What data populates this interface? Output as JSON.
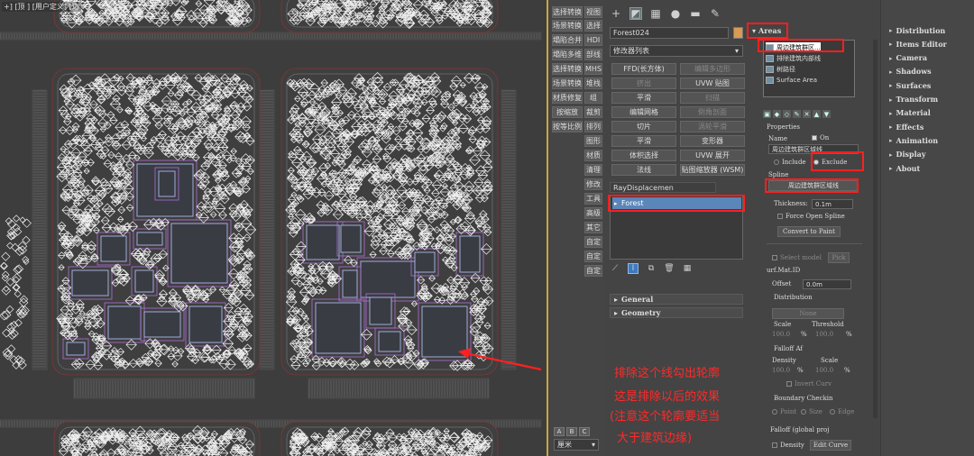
{
  "viewport": {
    "label": "+] [顶 ] [用户定义] [边",
    "annotations": [
      "排除这个线勾出轮廓",
      "这是排除以后的效果",
      "(注意这个轮廓要适当",
      "大于建筑边缘)"
    ]
  },
  "toolstrip": {
    "rows": [
      [
        "选择转换",
        "视图"
      ],
      [
        "场景转换",
        "选择"
      ],
      [
        "塌陷合并",
        "HDI"
      ],
      [
        "塌陷多维",
        "部线"
      ],
      [
        "选择转换",
        "MHS"
      ],
      [
        "场景转换",
        "堆栈"
      ],
      [
        "材质修复",
        "组"
      ],
      [
        "按缩放",
        "裁剪"
      ],
      [
        "按等比例",
        "排列"
      ]
    ],
    "side_items": [
      "图形",
      "材质",
      "清理",
      "修改",
      "工具",
      "高级",
      "其它",
      "自定",
      "自定",
      "自定"
    ],
    "abc": [
      "A",
      "B",
      "C"
    ],
    "unit": "厘米"
  },
  "command_panel": {
    "tab_icons": [
      "plus-icon",
      "modify-icon",
      "hierarchy-icon",
      "motion-icon",
      "display-icon",
      "utilities-icon"
    ],
    "object_name": "Forest024",
    "object_color": "#d99a54",
    "modifier_list": "修改器列表",
    "modifier_buttons": [
      {
        "label": "FFD(长方体)",
        "dim": false
      },
      {
        "label": "编辑多边形",
        "dim": true
      },
      {
        "label": "挤出",
        "dim": true
      },
      {
        "label": "UVW 贴图",
        "dim": false
      },
      {
        "label": "平滑",
        "dim": false
      },
      {
        "label": "扫描",
        "dim": true
      },
      {
        "label": "编辑网格",
        "dim": false
      },
      {
        "label": "倒角剖面",
        "dim": true
      },
      {
        "label": "切片",
        "dim": false
      },
      {
        "label": "涡轮平滑",
        "dim": true
      },
      {
        "label": "平滑",
        "dim": false
      },
      {
        "label": "变形器",
        "dim": false
      },
      {
        "label": "体积选择",
        "dim": false
      },
      {
        "label": "UVW 展开",
        "dim": false
      },
      {
        "label": "法线",
        "dim": false
      },
      {
        "label": "贴图缩放器 (WSM)",
        "dim": false
      }
    ],
    "raydisp": "RayDisplacemen",
    "stack_item": "Forest",
    "rollouts": [
      "General",
      "Geometry"
    ]
  },
  "areas": {
    "header": "Areas",
    "list": [
      {
        "label": "周边建筑群区...",
        "selected": true
      },
      {
        "label": "排除建筑内部线",
        "selected": false
      },
      {
        "label": "树路径",
        "selected": false
      },
      {
        "label": "Surface Area",
        "selected": false
      }
    ],
    "properties_label": "Properties",
    "name_label": "Name",
    "on_label": "On",
    "name_value": "周边建筑群区域线",
    "include_label": "Include",
    "exclude_label": "Exclude",
    "spline_label": "Spline",
    "spline_value": "周边建筑群区域线",
    "thickness_label": "Thickness:",
    "thickness_value": "0.1m",
    "force_open_label": "Force Open Spline",
    "convert_label": "Convert to Paint",
    "select_model_label": "Select model",
    "pick_label": "Pick",
    "surf_label": "urf.Mat.ID",
    "offset_label": "Offset",
    "offset_value": "0.0m",
    "distribution_label": "Distribution",
    "none_label": "None",
    "scale_label": "Scale",
    "threshold_label": "Threshold",
    "hundred": "100.0",
    "pct": "%",
    "falloff_label": "Falloff Af",
    "density_label": "Density",
    "scale2_label": "Scale",
    "invert_curve_label": "Invert Curv",
    "boundary_label": "Boundary Checkin",
    "point_label": "Point",
    "size_label": "Size",
    "edge_label": "Edge",
    "falloff_global_label": "Falloff (global proj",
    "density2_label": "Density",
    "edit_curve_label": "Edit Curve"
  },
  "rollout_menu": [
    "Distribution",
    "Items Editor",
    "Camera",
    "Shadows",
    "Surfaces",
    "Transform",
    "Material",
    "Effects",
    "Animation",
    "Display",
    "About"
  ]
}
